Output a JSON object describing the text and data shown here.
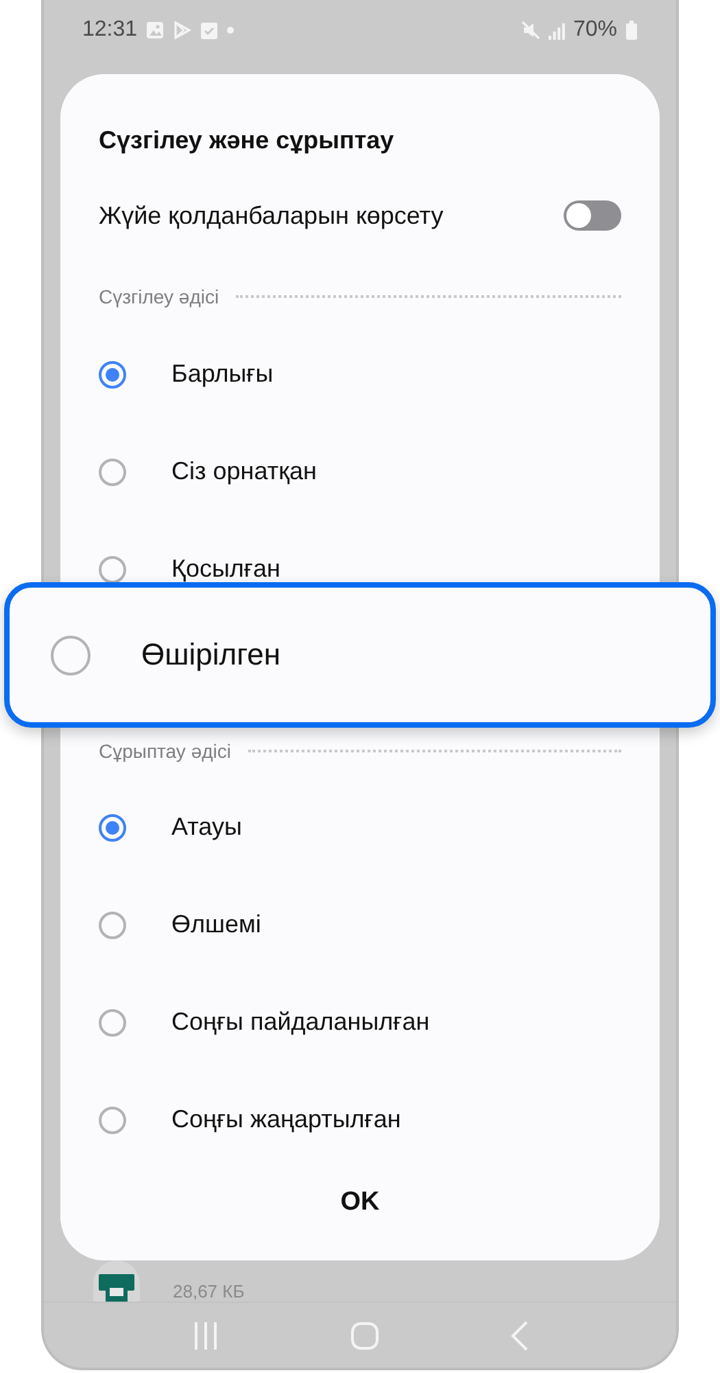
{
  "status_bar": {
    "time": "12:31",
    "battery": "70%"
  },
  "dialog": {
    "title": "Сүзгілеу және сұрыптау",
    "toggle": {
      "label": "Жүйе қолданбаларын көрсету",
      "on": false
    },
    "sections": [
      {
        "header": "Сүзгілеу әдісі",
        "options": [
          {
            "label": "Барлығы",
            "selected": true,
            "highlighted": false
          },
          {
            "label": "Сіз орнатқан",
            "selected": false,
            "highlighted": false
          },
          {
            "label": "Қосылған",
            "selected": false,
            "highlighted": false
          },
          {
            "label": "Өшірілген",
            "selected": false,
            "highlighted": true
          }
        ]
      },
      {
        "header": "Сұрыптау әдісі",
        "options": [
          {
            "label": "Атауы",
            "selected": true,
            "highlighted": false
          },
          {
            "label": "Өлшемі",
            "selected": false,
            "highlighted": false
          },
          {
            "label": "Соңғы пайдаланылған",
            "selected": false,
            "highlighted": false
          },
          {
            "label": "Соңғы жаңартылған",
            "selected": false,
            "highlighted": false
          }
        ]
      }
    ],
    "ok_button": "OK"
  },
  "background_item": {
    "size": "28,67 КБ"
  }
}
